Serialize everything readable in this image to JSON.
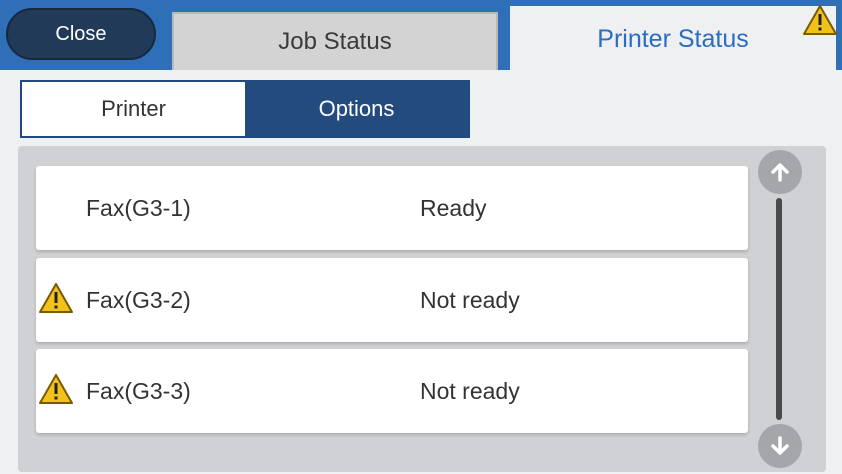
{
  "header": {
    "close_label": "Close",
    "tabs": [
      {
        "label": "Job Status",
        "active": false
      },
      {
        "label": "Printer Status",
        "active": true
      }
    ],
    "warning_icon": "warning-icon"
  },
  "subtabs": [
    {
      "label": "Printer",
      "active": false
    },
    {
      "label": "Options",
      "active": true
    }
  ],
  "list": {
    "rows": [
      {
        "name": "Fax(G3-1)",
        "status": "Ready",
        "warning": false
      },
      {
        "name": "Fax(G3-2)",
        "status": "Not ready",
        "warning": true
      },
      {
        "name": "Fax(G3-3)",
        "status": "Not ready",
        "warning": true
      }
    ]
  },
  "scrollbar": {
    "up_icon": "arrow-up-icon",
    "down_icon": "arrow-down-icon"
  },
  "colors": {
    "header_blue": "#2f6fb7",
    "close_button": "#213a57",
    "active_subtab": "#244b7e",
    "active_tab_text": "#2b6cc4",
    "warning_yellow": "#f2c21b"
  }
}
